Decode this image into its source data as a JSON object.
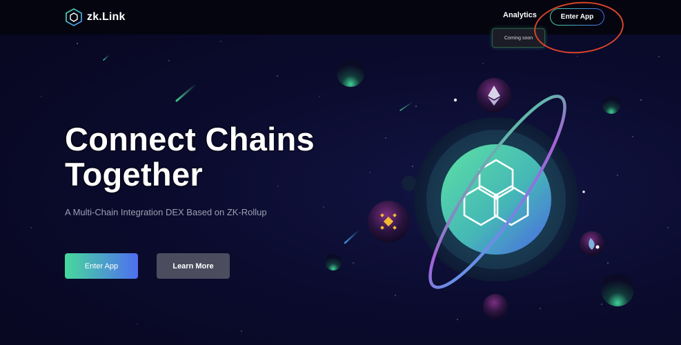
{
  "header": {
    "logo_text": "zk.Link",
    "nav": {
      "analytics_label": "Analytics",
      "enter_app_label": "Enter App"
    },
    "tooltip_text": "Coming soon"
  },
  "hero": {
    "title_line1": "Connect Chains",
    "title_line2": "Together",
    "subtitle": "A Multi-Chain Integration DEX Based on ZK-Rollup",
    "primary_button": "Enter App",
    "secondary_button": "Learn More"
  },
  "colors": {
    "background": "#0a0a2a",
    "accent_green": "#48d89a",
    "accent_blue": "#4a6cf0",
    "annotation_red": "#d9442a",
    "button_secondary": "#4b4d5e"
  },
  "icons": {
    "logo": "zklink-hexagon-icon",
    "center": "zklink-hexagon-cluster-icon",
    "planets": [
      "ethereum-icon",
      "binance-icon",
      "heco-icon"
    ]
  }
}
